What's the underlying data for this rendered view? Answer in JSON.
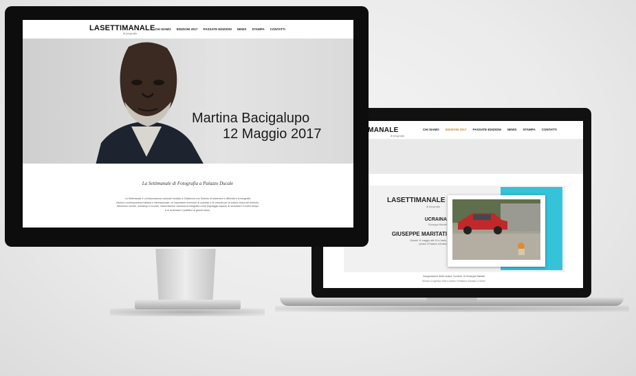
{
  "imac_site": {
    "logo": "LASETTIMANALE",
    "logo_sub": "di fotografia",
    "menu": [
      "CHI SIAMO",
      "EDIZIONI 2017",
      "PASSATE EDIZIONI",
      "NEWS",
      "STAMPA",
      "CONTATTI"
    ],
    "hero_title": "Martina Bacigalupo",
    "hero_date": "12 Maggio 2017",
    "tagline": "La Settimanale di Fotografia a Palazzo Ducale",
    "body_lines": [
      "La Settimanale è un'Associazione culturale fondata a Giulianova con l'intento di sostenere e diffondere la fotografia",
      "d'autore contemporanea italiana e internazionale: un importante momento di scambio e di crescita per la cultura visiva del territorio.",
      "Attraverso mostre, workshop e incontri, l'associazione valorizza la fotografia come linguaggio capace di raccontare il nostro tempo",
      "e di avvicinare il pubblico ai grandi autori."
    ]
  },
  "laptop_site": {
    "logo": "IMANALE",
    "logo_sub": "di fotografia",
    "menu": [
      {
        "label": "CHI SIAMO",
        "active": false
      },
      {
        "label": "EDIZIONI 2017",
        "active": true
      },
      {
        "label": "PASSATE EDIZIONI",
        "active": false
      },
      {
        "label": "NEWS",
        "active": false
      },
      {
        "label": "STAMPA",
        "active": false
      },
      {
        "label": "CONTATTI",
        "active": false
      }
    ],
    "band_text": "E",
    "card_logo": "LASETTIMANALE",
    "card_logo_sub": "di fotografia",
    "exhibition_title": "UCRAINA",
    "exhibition_sub": "Giuseppe Maritati",
    "author": "GIUSEPPE MARITATI",
    "author_details": [
      "Giovedì 11 maggio alle 19 a Vasto,",
      "presso il Palazzo d'Avalos"
    ],
    "footer_line1": "Inaugurazione della mostra \"Ucraina\" di Giuseppe Maritati",
    "footer_line2": "Mostra a ingresso libero presso il Palazzo d'Avalos a Vasto",
    "accent_color": "#36c2d8"
  }
}
